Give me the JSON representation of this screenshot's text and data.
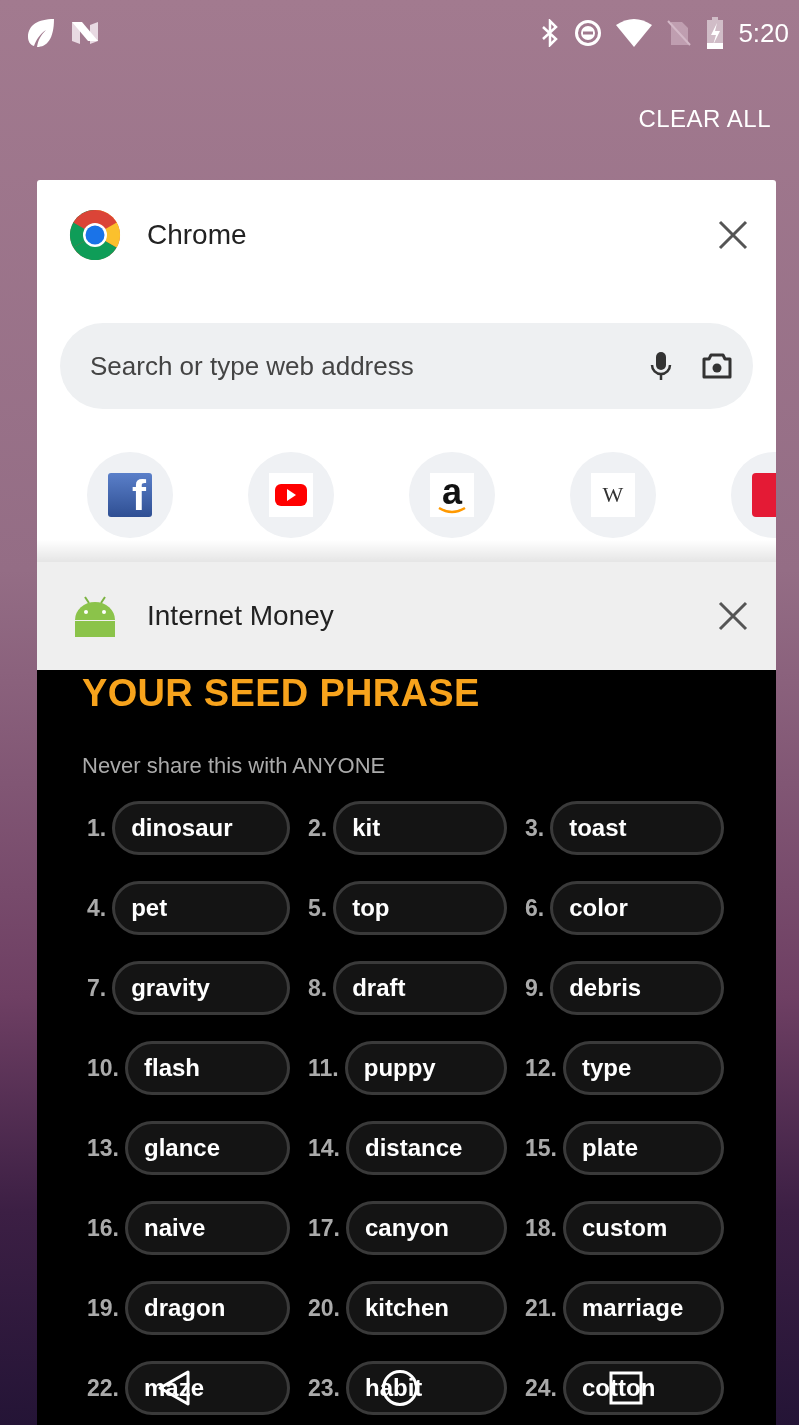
{
  "status_bar": {
    "time": "5:20"
  },
  "clear_all": "CLEAR ALL",
  "cards": [
    {
      "kind": "browser",
      "app_name": "Chrome",
      "search": {
        "placeholder": "Search or type web address"
      },
      "shortcuts": [
        {
          "kind": "facebook",
          "glyph": "f"
        },
        {
          "kind": "youtube"
        },
        {
          "kind": "amazon",
          "glyph": "a"
        },
        {
          "kind": "wikipedia",
          "glyph": "W"
        },
        {
          "kind": "espn"
        }
      ]
    },
    {
      "kind": "wallet",
      "app_name": "Internet Money",
      "title": "YOUR SEED PHRASE",
      "warning": "Never share this with ANYONE",
      "words": [
        {
          "number": "1.",
          "word": "dinosaur"
        },
        {
          "number": "2.",
          "word": "kit"
        },
        {
          "number": "3.",
          "word": "toast"
        },
        {
          "number": "4.",
          "word": "pet"
        },
        {
          "number": "5.",
          "word": "top"
        },
        {
          "number": "6.",
          "word": "color"
        },
        {
          "number": "7.",
          "word": "gravity"
        },
        {
          "number": "8.",
          "word": "draft"
        },
        {
          "number": "9.",
          "word": "debris"
        },
        {
          "number": "10.",
          "word": "flash"
        },
        {
          "number": "11.",
          "word": "puppy"
        },
        {
          "number": "12.",
          "word": "type"
        },
        {
          "number": "13.",
          "word": "glance"
        },
        {
          "number": "14.",
          "word": "distance"
        },
        {
          "number": "15.",
          "word": "plate"
        },
        {
          "number": "16.",
          "word": "naive"
        },
        {
          "number": "17.",
          "word": "canyon"
        },
        {
          "number": "18.",
          "word": "custom"
        },
        {
          "number": "19.",
          "word": "dragon"
        },
        {
          "number": "20.",
          "word": "kitchen"
        },
        {
          "number": "21.",
          "word": "marriage"
        },
        {
          "number": "22.",
          "word": "maze"
        },
        {
          "number": "23.",
          "word": "habit"
        },
        {
          "number": "24.",
          "word": "cotton"
        }
      ]
    }
  ]
}
